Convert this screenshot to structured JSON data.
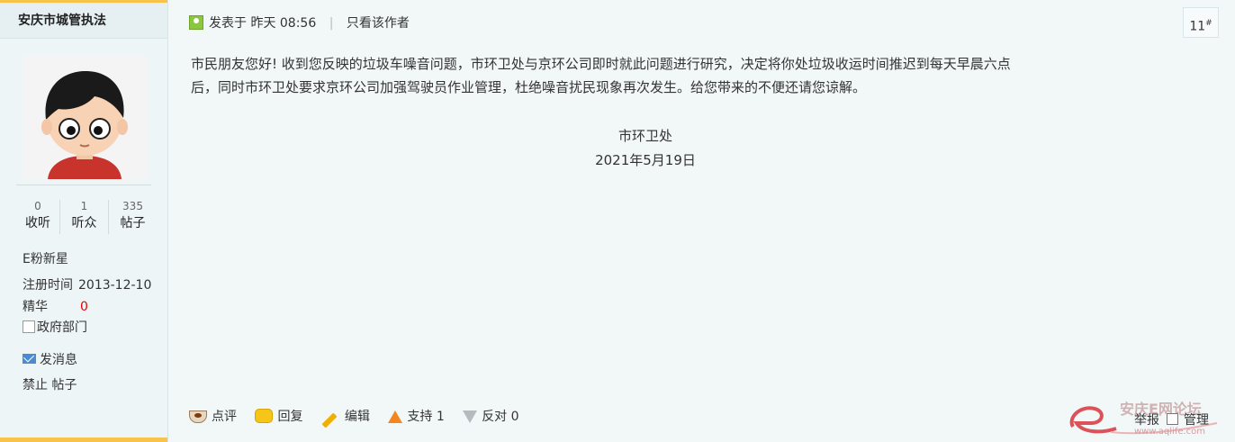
{
  "sidebar": {
    "username": "安庆市城管执法",
    "stats": [
      {
        "num": "0",
        "label": "收听"
      },
      {
        "num": "1",
        "label": "听众"
      },
      {
        "num": "335",
        "label": "帖子"
      }
    ],
    "rank": "E粉新星",
    "reg_label": "注册时间",
    "reg_value": "2013-12-10",
    "essence_label": "精华",
    "essence_value": "0",
    "group_image_alt": "政府部门",
    "send_message": "发消息",
    "ban_label": "禁止",
    "posts_link": "帖子"
  },
  "post": {
    "posted_label": "发表于",
    "posted_time": "昨天 08:56",
    "author_only": "只看该作者",
    "floor_number": "11",
    "floor_mark": "#",
    "body": "市民朋友您好! 收到您反映的垃圾车噪音问题，市环卫处与京环公司即时就此问题进行研究，决定将你处垃圾收运时间推迟到每天早晨六点后，同时市环卫处要求京环公司加强驾驶员作业管理，杜绝噪音扰民现象再次发生。给您带来的不便还请您谅解。",
    "sign_org": "市环卫处",
    "sign_date": "2021年5月19日"
  },
  "actions": {
    "comment": "点评",
    "reply": "回复",
    "edit": "编辑",
    "support": "支持",
    "support_count": "1",
    "oppose": "反对",
    "oppose_count": "0",
    "report": "举报",
    "manage": "管理"
  },
  "watermark": {
    "text": "安庆E网论坛",
    "url": "www.aqlife.com"
  },
  "colors": {
    "accent_bar": "#f7c34a",
    "background": "#f2f7f8",
    "sidebar": "#edf5f6"
  }
}
